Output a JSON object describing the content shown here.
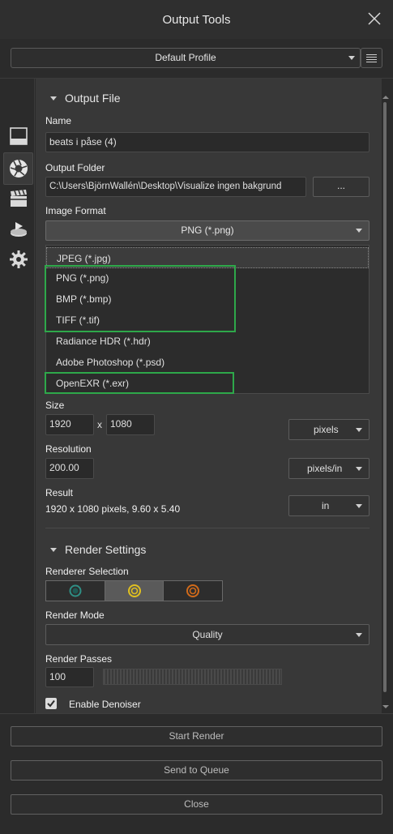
{
  "window": {
    "title": "Output Tools"
  },
  "profile": {
    "value": "Default Profile"
  },
  "sections": {
    "output_file": "Output File",
    "render_settings": "Render Settings"
  },
  "labels": {
    "name": "Name",
    "output_folder": "Output Folder",
    "image_format": "Image Format",
    "size": "Size",
    "resolution": "Resolution",
    "result": "Result",
    "renderer_selection": "Renderer Selection",
    "render_mode": "Render Mode",
    "render_passes": "Render Passes",
    "enable_denoiser": "Enable Denoiser"
  },
  "fields": {
    "name": "beats i påse (4)",
    "output_folder": "C:\\Users\\BjörnWallén\\Desktop\\Visualize ingen bakgrund",
    "browse_label": "...",
    "image_format": "PNG (*.png)",
    "width": "1920",
    "height": "1080",
    "size_x": "x",
    "size_unit": "pixels",
    "resolution": "200.00",
    "resolution_unit": "pixels/in",
    "result_text": "1920 x 1080 pixels, 9.60 x 5.40",
    "result_unit": "in",
    "render_mode": "Quality",
    "render_passes": "100",
    "denoiser_checked": true
  },
  "format_options": [
    "JPEG (*.jpg)",
    "PNG (*.png)",
    "BMP (*.bmp)",
    "TIFF (*.tif)",
    "Radiance HDR (*.hdr)",
    "Adobe Photoshop (*.psd)",
    "OpenEXR (*.exr)"
  ],
  "renderers": {
    "selected_index": 1,
    "colors": [
      "#2f8f85",
      "#e0c020",
      "#d06a1a"
    ]
  },
  "buttons": {
    "start_render": "Start Render",
    "send_to_queue": "Send to Queue",
    "close": "Close"
  },
  "highlight_color": "#2ea84a"
}
